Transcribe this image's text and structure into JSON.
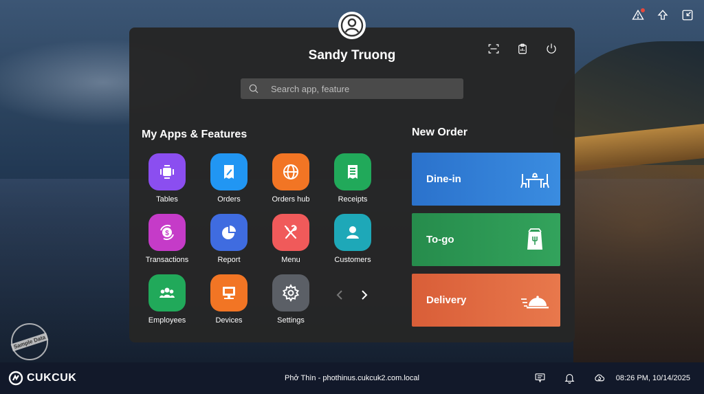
{
  "user": {
    "name": "Sandy Truong"
  },
  "search": {
    "placeholder": "Search app, feature"
  },
  "apps_section": {
    "title": "My Apps & Features",
    "apps": [
      {
        "label": "Tables",
        "icon": "tables-icon",
        "color": "#8b4ef0"
      },
      {
        "label": "Orders",
        "icon": "orders-icon",
        "color": "#2196f3"
      },
      {
        "label": "Orders hub",
        "icon": "globe-icon",
        "color": "#f27524"
      },
      {
        "label": "Receipts",
        "icon": "receipts-icon",
        "color": "#21a95a"
      },
      {
        "label": "Transactions",
        "icon": "transactions-icon",
        "color": "#c53bc8"
      },
      {
        "label": "Report",
        "icon": "pie-chart-icon",
        "color": "#3f6ce0"
      },
      {
        "label": "Menu",
        "icon": "fork-knife-icon",
        "color": "#f05a5a"
      },
      {
        "label": "Customers",
        "icon": "user-icon",
        "color": "#1ea8b8"
      },
      {
        "label": "Employees",
        "icon": "group-icon",
        "color": "#21a95a"
      },
      {
        "label": "Devices",
        "icon": "monitor-icon",
        "color": "#f27524"
      },
      {
        "label": "Settings",
        "icon": "gear-icon",
        "color": "#5b5f66"
      }
    ]
  },
  "new_order": {
    "title": "New Order",
    "options": [
      {
        "label": "Dine-in",
        "icon": "dine-in-icon",
        "color": "#2e7fd6"
      },
      {
        "label": "To-go",
        "icon": "to-go-bag-icon",
        "color": "#2c9a55"
      },
      {
        "label": "Delivery",
        "icon": "delivery-cloche-icon",
        "color": "#e06a40"
      }
    ]
  },
  "sample_stamp": "Sample Data",
  "bottom_bar": {
    "brand": "CUKCUK",
    "store": "Phở Thìn - phothinus.cukcuk2.com.local",
    "datetime": "08:26 PM, 10/14/2025"
  }
}
